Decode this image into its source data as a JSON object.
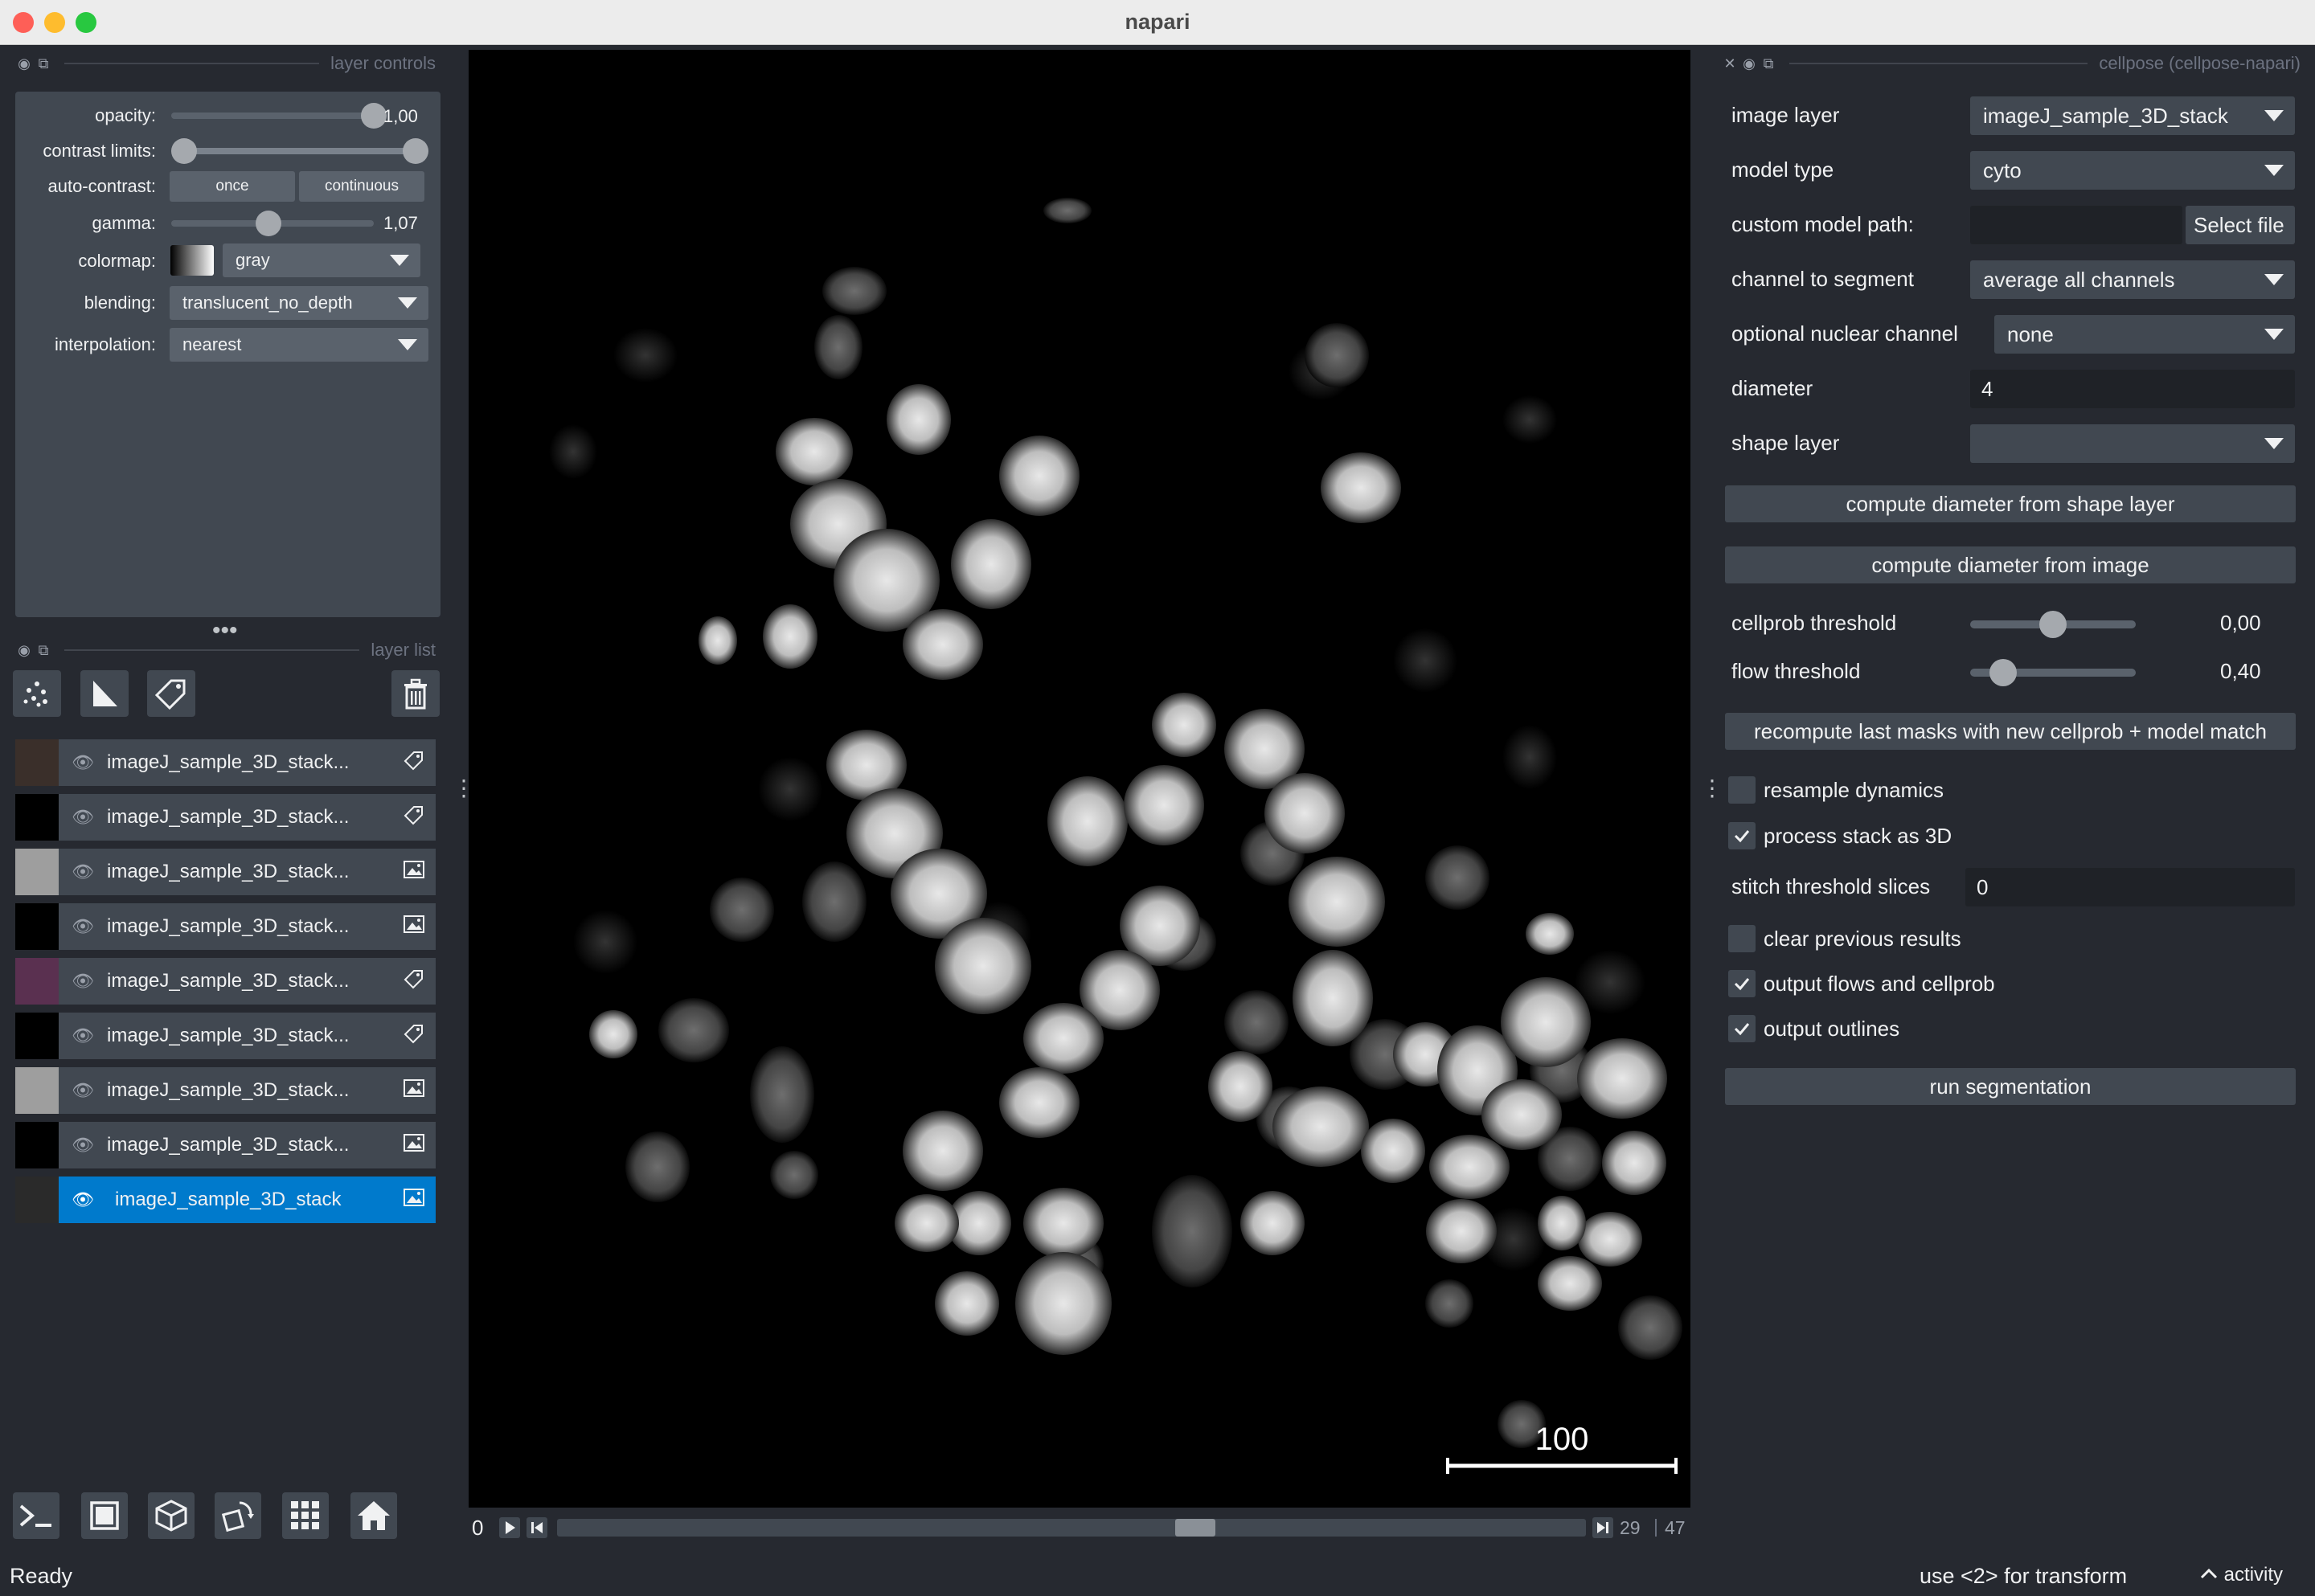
{
  "window": {
    "title": "napari"
  },
  "layer_controls": {
    "header": "layer controls",
    "opacity": {
      "label": "opacity:",
      "value": "1,00",
      "fraction": 1.0
    },
    "contrast": {
      "label": "contrast limits:"
    },
    "auto_contrast": {
      "label": "auto-contrast:",
      "once": "once",
      "continuous": "continuous"
    },
    "gamma": {
      "label": "gamma:",
      "value": "1,07",
      "fraction": 0.48
    },
    "colormap": {
      "label": "colormap:",
      "value": "gray"
    },
    "blending": {
      "label": "blending:",
      "value": "translucent_no_depth"
    },
    "interpolation": {
      "label": "interpolation:",
      "value": "nearest"
    }
  },
  "layer_list": {
    "header": "layer list",
    "layers": [
      {
        "name": "imageJ_sample_3D_stack...",
        "type": "labels",
        "thumb": "#3a2f2a"
      },
      {
        "name": "imageJ_sample_3D_stack...",
        "type": "labels",
        "thumb": "#000000"
      },
      {
        "name": "imageJ_sample_3D_stack...",
        "type": "image",
        "thumb": "#9e9e9e"
      },
      {
        "name": "imageJ_sample_3D_stack...",
        "type": "image",
        "thumb": "#000000"
      },
      {
        "name": "imageJ_sample_3D_stack...",
        "type": "labels",
        "thumb": "#5a3050"
      },
      {
        "name": "imageJ_sample_3D_stack...",
        "type": "labels",
        "thumb": "#000000"
      },
      {
        "name": "imageJ_sample_3D_stack...",
        "type": "image",
        "thumb": "#9e9e9e"
      },
      {
        "name": "imageJ_sample_3D_stack...",
        "type": "image",
        "thumb": "#000000"
      },
      {
        "name": "imageJ_sample_3D_stack",
        "type": "image",
        "thumb": "#2a2a2a",
        "selected": true
      }
    ]
  },
  "canvas": {
    "scale_bar": "100"
  },
  "dims": {
    "start": "0",
    "current": "29",
    "max": "47",
    "fraction": 0.62
  },
  "status": {
    "left": "Ready",
    "hint": "use <2> for transform",
    "activity": "activity"
  },
  "cellpose": {
    "header": "cellpose (cellpose-napari)",
    "image_layer": {
      "label": "image layer",
      "value": "imageJ_sample_3D_stack"
    },
    "model_type": {
      "label": "model type",
      "value": "cyto"
    },
    "custom_model": {
      "label": "custom model path:",
      "button": "Select file"
    },
    "channel": {
      "label": "channel to segment",
      "value": "average all channels"
    },
    "nuclear": {
      "label": "optional nuclear channel",
      "value": "none"
    },
    "diameter": {
      "label": "diameter",
      "value": "4"
    },
    "shape_layer": {
      "label": "shape layer",
      "value": ""
    },
    "btn_diam_shape": "compute diameter from shape layer",
    "btn_diam_image": "compute diameter from image",
    "cellprob": {
      "label": "cellprob threshold",
      "value": "0,00",
      "fraction": 0.5
    },
    "flow": {
      "label": "flow threshold",
      "value": "0,40",
      "fraction": 0.2
    },
    "btn_recompute": "recompute last masks with new cellprob + model match",
    "resample": {
      "label": "resample dynamics",
      "checked": false
    },
    "process3d": {
      "label": "process stack as 3D",
      "checked": true
    },
    "stitch": {
      "label": "stitch threshold slices",
      "value": "0"
    },
    "clear_prev": {
      "label": "clear previous results",
      "checked": false
    },
    "out_flows": {
      "label": "output flows and cellprob",
      "checked": true
    },
    "out_outlines": {
      "label": "output outlines",
      "checked": true
    },
    "btn_run": "run segmentation"
  }
}
